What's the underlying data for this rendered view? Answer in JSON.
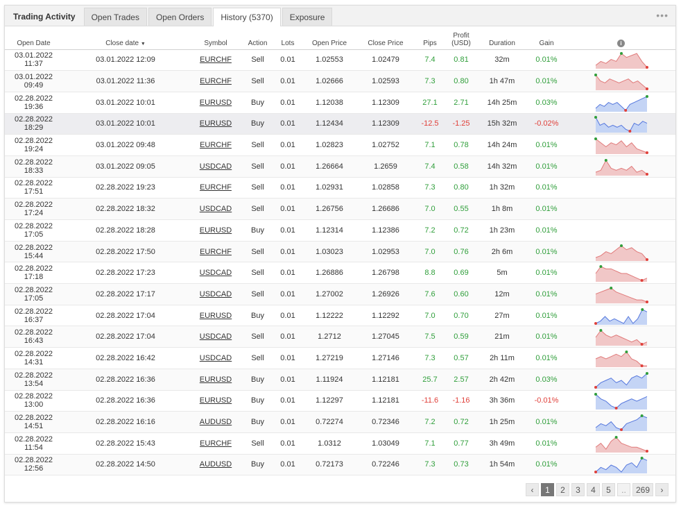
{
  "tabs": [
    {
      "label": "Trading Activity"
    },
    {
      "label": "Open Trades"
    },
    {
      "label": "Open Orders"
    },
    {
      "label": "History (5370)"
    },
    {
      "label": "Exposure"
    }
  ],
  "menu_icon": "more-dots-icon",
  "colors": {
    "positive": "#2f9e3a",
    "negative": "#e0403a",
    "sell_fill": "#f1c7c7",
    "sell_line": "#e07a7a",
    "buy_fill": "#c4d4f5",
    "buy_line": "#5577dd"
  },
  "columns": {
    "open_date": "Open Date",
    "close_date": "Close date",
    "close_date_sort": "▼",
    "symbol": "Symbol",
    "action": "Action",
    "lots": "Lots",
    "open_price": "Open Price",
    "close_price": "Close Price",
    "pips": "Pips",
    "profit_l1": "Profit",
    "profit_l2": "(USD)",
    "duration": "Duration",
    "gain": "Gain",
    "info": "i"
  },
  "rows": [
    {
      "open": "03.01.2022 11:37",
      "close": "03.01.2022 12:09",
      "symbol": "EURCHF",
      "action": "Sell",
      "lots": "0.01",
      "open_price": "1.02553",
      "close_price": "1.02479",
      "pips": "7.4",
      "profit": "0.81",
      "duration": "32m",
      "gain": "0.01%",
      "spark": [
        3,
        5,
        4,
        6,
        5,
        9,
        7,
        8,
        9,
        5,
        2
      ]
    },
    {
      "open": "03.01.2022 09:49",
      "close": "03.01.2022 11:36",
      "symbol": "EURCHF",
      "action": "Sell",
      "lots": "0.01",
      "open_price": "1.02666",
      "close_price": "1.02593",
      "pips": "7.3",
      "profit": "0.80",
      "duration": "1h 47m",
      "gain": "0.01%",
      "spark": [
        9,
        6,
        5,
        7,
        6,
        5,
        6,
        7,
        5,
        6,
        4,
        2
      ]
    },
    {
      "open": "02.28.2022 19:36",
      "close": "03.01.2022 10:01",
      "symbol": "EURUSD",
      "action": "Buy",
      "lots": "0.01",
      "open_price": "1.12038",
      "close_price": "1.12309",
      "pips": "27.1",
      "profit": "2.71",
      "duration": "14h 25m",
      "gain": "0.03%",
      "spark": [
        3,
        5,
        4,
        6,
        5,
        6,
        4,
        2,
        5,
        6,
        7,
        8,
        9
      ]
    },
    {
      "open": "02.28.2022 18:29",
      "close": "03.01.2022 10:01",
      "symbol": "EURUSD",
      "action": "Buy",
      "lots": "0.01",
      "open_price": "1.12434",
      "close_price": "1.12309",
      "pips": "-12.5",
      "profit": "-1.25",
      "duration": "15h 32m",
      "gain": "-0.02%",
      "spark": [
        9,
        5,
        6,
        4,
        5,
        4,
        5,
        3,
        2,
        6,
        5,
        7,
        6
      ]
    },
    {
      "open": "02.28.2022 19:24",
      "close": "03.01.2022 09:48",
      "symbol": "EURCHF",
      "action": "Sell",
      "lots": "0.01",
      "open_price": "1.02823",
      "close_price": "1.02752",
      "pips": "7.1",
      "profit": "0.78",
      "duration": "14h 24m",
      "gain": "0.01%",
      "spark": [
        9,
        7,
        5,
        7,
        6,
        8,
        5,
        7,
        4,
        3,
        2
      ]
    },
    {
      "open": "02.28.2022 18:33",
      "close": "03.01.2022 09:05",
      "symbol": "USDCAD",
      "action": "Sell",
      "lots": "0.01",
      "open_price": "1.26664",
      "close_price": "1.2659",
      "pips": "7.4",
      "profit": "0.58",
      "duration": "14h 32m",
      "gain": "0.01%",
      "spark": [
        3,
        4,
        9,
        5,
        4,
        5,
        4,
        6,
        3,
        4,
        2
      ]
    },
    {
      "open": "02.28.2022 17:51",
      "close": "02.28.2022 19:23",
      "symbol": "EURCHF",
      "action": "Sell",
      "lots": "0.01",
      "open_price": "1.02931",
      "close_price": "1.02858",
      "pips": "7.3",
      "profit": "0.80",
      "duration": "1h 32m",
      "gain": "0.01%",
      "spark": null
    },
    {
      "open": "02.28.2022 17:24",
      "close": "02.28.2022 18:32",
      "symbol": "USDCAD",
      "action": "Sell",
      "lots": "0.01",
      "open_price": "1.26756",
      "close_price": "1.26686",
      "pips": "7.0",
      "profit": "0.55",
      "duration": "1h 8m",
      "gain": "0.01%",
      "spark": null
    },
    {
      "open": "02.28.2022 17:05",
      "close": "02.28.2022 18:28",
      "symbol": "EURUSD",
      "action": "Buy",
      "lots": "0.01",
      "open_price": "1.12314",
      "close_price": "1.12386",
      "pips": "7.2",
      "profit": "0.72",
      "duration": "1h 23m",
      "gain": "0.01%",
      "spark": null
    },
    {
      "open": "02.28.2022 15:44",
      "close": "02.28.2022 17:50",
      "symbol": "EURCHF",
      "action": "Sell",
      "lots": "0.01",
      "open_price": "1.03023",
      "close_price": "1.02953",
      "pips": "7.0",
      "profit": "0.76",
      "duration": "2h 6m",
      "gain": "0.01%",
      "spark": [
        3,
        4,
        6,
        5,
        7,
        9,
        7,
        8,
        6,
        5,
        2
      ]
    },
    {
      "open": "02.28.2022 17:18",
      "close": "02.28.2022 17:23",
      "symbol": "USDCAD",
      "action": "Sell",
      "lots": "0.01",
      "open_price": "1.26886",
      "close_price": "1.26798",
      "pips": "8.8",
      "profit": "0.69",
      "duration": "5m",
      "gain": "0.01%",
      "spark": [
        5,
        8,
        7,
        7,
        6,
        5,
        5,
        4,
        3,
        2,
        3
      ]
    },
    {
      "open": "02.28.2022 17:05",
      "close": "02.28.2022 17:17",
      "symbol": "USDCAD",
      "action": "Sell",
      "lots": "0.01",
      "open_price": "1.27002",
      "close_price": "1.26926",
      "pips": "7.6",
      "profit": "0.60",
      "duration": "12m",
      "gain": "0.01%",
      "spark": [
        6,
        7,
        8,
        9,
        7,
        6,
        5,
        4,
        3,
        3,
        2
      ]
    },
    {
      "open": "02.28.2022 16:37",
      "close": "02.28.2022 17:04",
      "symbol": "EURUSD",
      "action": "Buy",
      "lots": "0.01",
      "open_price": "1.12222",
      "close_price": "1.12292",
      "pips": "7.0",
      "profit": "0.70",
      "duration": "27m",
      "gain": "0.01%",
      "spark": [
        3,
        4,
        6,
        4,
        5,
        4,
        3,
        6,
        3,
        5,
        9,
        8
      ]
    },
    {
      "open": "02.28.2022 16:43",
      "close": "02.28.2022 17:04",
      "symbol": "USDCAD",
      "action": "Sell",
      "lots": "0.01",
      "open_price": "1.2712",
      "close_price": "1.27045",
      "pips": "7.5",
      "profit": "0.59",
      "duration": "21m",
      "gain": "0.01%",
      "spark": [
        6,
        9,
        7,
        6,
        7,
        6,
        5,
        4,
        5,
        3,
        4
      ]
    },
    {
      "open": "02.28.2022 14:31",
      "close": "02.28.2022 16:42",
      "symbol": "USDCAD",
      "action": "Sell",
      "lots": "0.01",
      "open_price": "1.27219",
      "close_price": "1.27146",
      "pips": "7.3",
      "profit": "0.57",
      "duration": "2h 11m",
      "gain": "0.01%",
      "spark": [
        5,
        6,
        5,
        6,
        7,
        6,
        8,
        5,
        4,
        2,
        2
      ]
    },
    {
      "open": "02.28.2022 13:54",
      "close": "02.28.2022 16:36",
      "symbol": "EURUSD",
      "action": "Buy",
      "lots": "0.01",
      "open_price": "1.11924",
      "close_price": "1.12181",
      "pips": "25.7",
      "profit": "2.57",
      "duration": "2h 42m",
      "gain": "0.03%",
      "spark": [
        3,
        5,
        6,
        7,
        5,
        6,
        4,
        7,
        8,
        7,
        9
      ]
    },
    {
      "open": "02.28.2022 13:00",
      "close": "02.28.2022 16:36",
      "symbol": "EURUSD",
      "action": "Buy",
      "lots": "0.01",
      "open_price": "1.12297",
      "close_price": "1.12181",
      "pips": "-11.6",
      "profit": "-1.16",
      "duration": "3h 36m",
      "gain": "-0.01%",
      "spark": [
        9,
        7,
        6,
        4,
        3,
        5,
        6,
        7,
        6,
        7,
        8
      ]
    },
    {
      "open": "02.28.2022 14:51",
      "close": "02.28.2022 16:16",
      "symbol": "AUDUSD",
      "action": "Buy",
      "lots": "0.01",
      "open_price": "0.72274",
      "close_price": "0.72346",
      "pips": "7.2",
      "profit": "0.72",
      "duration": "1h 25m",
      "gain": "0.01%",
      "spark": [
        3,
        5,
        4,
        6,
        3,
        2,
        5,
        6,
        7,
        9,
        8
      ]
    },
    {
      "open": "02.28.2022 11:54",
      "close": "02.28.2022 15:43",
      "symbol": "EURCHF",
      "action": "Sell",
      "lots": "0.01",
      "open_price": "1.0312",
      "close_price": "1.03049",
      "pips": "7.1",
      "profit": "0.77",
      "duration": "3h 49m",
      "gain": "0.01%",
      "spark": [
        4,
        6,
        3,
        7,
        9,
        6,
        5,
        4,
        4,
        3,
        2
      ]
    },
    {
      "open": "02.28.2022 12:56",
      "close": "02.28.2022 14:50",
      "symbol": "AUDUSD",
      "action": "Buy",
      "lots": "0.01",
      "open_price": "0.72173",
      "close_price": "0.72246",
      "pips": "7.3",
      "profit": "0.73",
      "duration": "1h 54m",
      "gain": "0.01%",
      "spark": [
        3,
        5,
        4,
        6,
        5,
        3,
        6,
        7,
        5,
        9,
        8
      ]
    }
  ],
  "pagination": {
    "prev": "‹",
    "pages": [
      "1",
      "2",
      "3",
      "4",
      "5"
    ],
    "dots": "..",
    "last": "269",
    "next": "›",
    "current": "1"
  }
}
